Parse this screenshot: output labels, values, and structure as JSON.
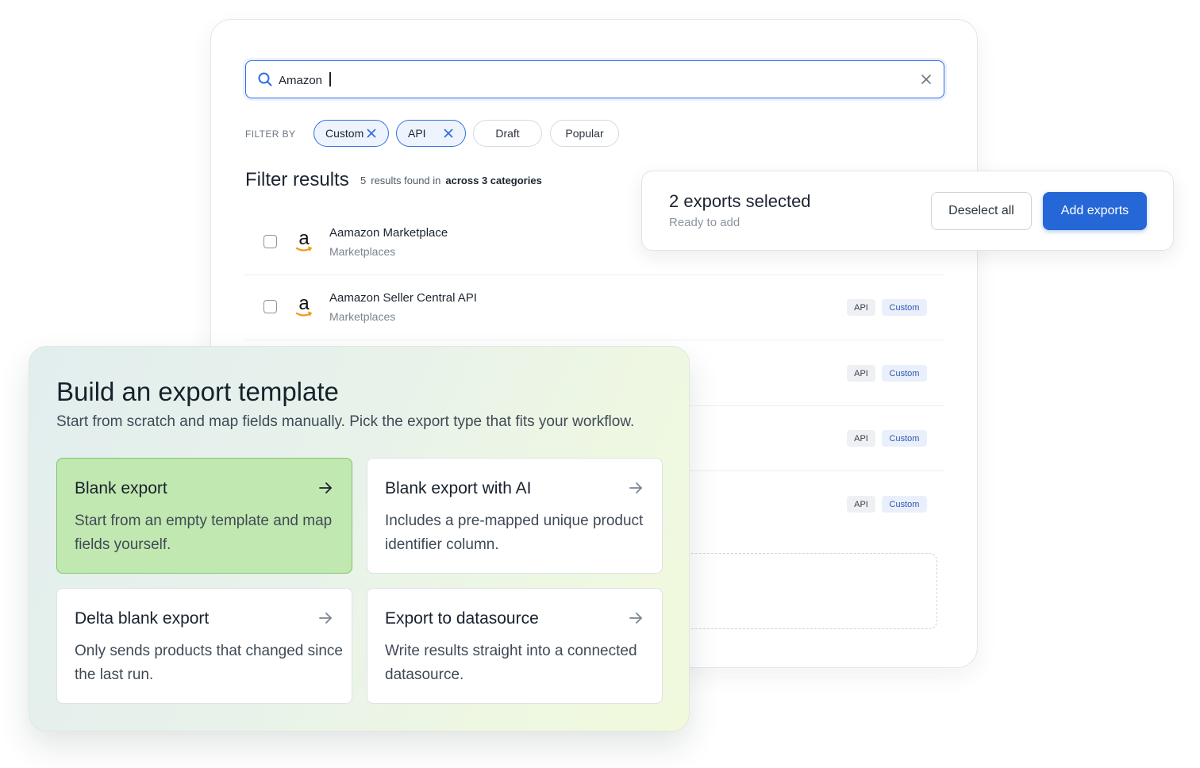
{
  "search": {
    "value": "Amazon"
  },
  "filters": {
    "label": "FILTER BY",
    "chips": [
      {
        "label": "Custom",
        "active": true
      },
      {
        "label": "API",
        "active": true
      },
      {
        "label": "Draft",
        "active": false
      },
      {
        "label": "Popular",
        "active": false
      }
    ]
  },
  "results": {
    "title": "Filter results",
    "count": "5",
    "found_text": "results found in",
    "categories_text": "across 3 categories",
    "rows": [
      {
        "name": "Aamazon Marketplace",
        "category": "Marketplaces",
        "tags": []
      },
      {
        "name": "Aamazon Seller Central API",
        "category": "Marketplaces",
        "tags": [
          "API",
          "Custom"
        ]
      },
      {
        "name": "",
        "category": "",
        "tags": [
          "API",
          "Custom"
        ]
      },
      {
        "name": "",
        "category": "",
        "tags": [
          "API",
          "Custom"
        ]
      },
      {
        "name": "",
        "category": "",
        "tags": [
          "API",
          "Custom"
        ]
      }
    ]
  },
  "selection": {
    "title": "2 exports selected",
    "subtitle": "Ready to add",
    "deselect_label": "Deselect all",
    "add_label": "Add exports"
  },
  "template": {
    "title": "Build an export template",
    "subtitle": "Start from scratch and map fields manually. Pick the export type that fits your workflow.",
    "options": [
      {
        "title": "Blank export",
        "description": "Start from an empty template and map fields yourself.",
        "selected": true
      },
      {
        "title": "Blank export with AI",
        "description": "Includes a pre-mapped unique product identifier column.",
        "selected": false
      },
      {
        "title": "Delta blank export",
        "description": "Only sends products that changed since the last run.",
        "selected": false
      },
      {
        "title": "Export to datasource",
        "description": "Write results straight into a connected datasource.",
        "selected": false
      }
    ]
  },
  "icons": {
    "search": "search-icon",
    "clear": "close-icon",
    "chip_remove": "close-icon",
    "logo": "amazon-logo-icon",
    "arrow": "arrow-right-icon"
  },
  "colors": {
    "accent": "#2567d6",
    "selected_option": "#c2e8b1",
    "tag_custom_text": "#2e55b0"
  }
}
